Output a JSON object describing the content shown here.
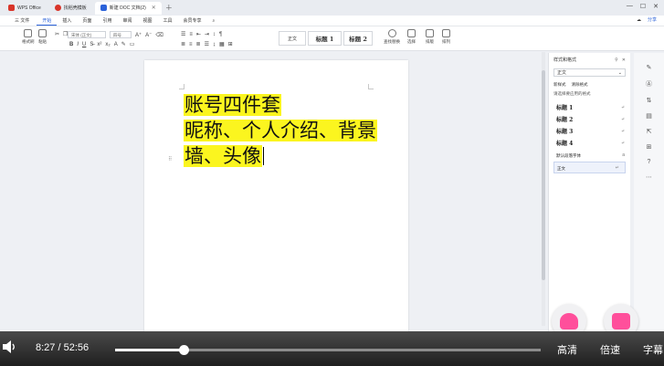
{
  "tabs": [
    {
      "label": "WPS Office",
      "color": "#d9352a"
    },
    {
      "label": "找稻壳模板",
      "color": "#d9352a"
    },
    {
      "label": "新建 DOC 文档(2)",
      "color": "#2b62d9",
      "active": true
    }
  ],
  "menu": {
    "file": "三 文件",
    "items": [
      "开始",
      "插入",
      "页面",
      "引用",
      "审阅",
      "视图",
      "工具",
      "会员专享"
    ],
    "active_index": 0,
    "share": "分享"
  },
  "toolbar": {
    "format_painter": "格式刷",
    "paste": "粘贴",
    "font_name": "宋体 (正文)",
    "font_size": "四号",
    "style_normal": "正文",
    "style_h1": "标题 1",
    "style_h2": "标题 2",
    "find_replace": "查找替换",
    "select": "选择",
    "sort": "排版",
    "layout": "排列"
  },
  "document": {
    "lines": [
      "账号四件套",
      "昵称、个人介绍、背景",
      "墙、头像"
    ]
  },
  "styles_pane": {
    "title": "样式和格式",
    "current_style": "正文",
    "new_style": "新样式",
    "clear_format": "清除格式",
    "caption": "请选择要应用的格式",
    "items": [
      {
        "label": "标题 1",
        "kind": "heading"
      },
      {
        "label": "标题 2",
        "kind": "heading"
      },
      {
        "label": "标题 3",
        "kind": "heading"
      },
      {
        "label": "标题 4",
        "kind": "heading"
      },
      {
        "label": "默认段落字体",
        "kind": "small"
      },
      {
        "label": "正文",
        "kind": "selected"
      }
    ]
  },
  "player": {
    "current_time": "8:27",
    "separator": "/",
    "total_time": "52:56",
    "progress": 0.1604,
    "quality_label": "高清",
    "speed_label": "倍速",
    "subtitle_label": "字幕"
  },
  "colors": {
    "highlight": "#fbf51f",
    "accent": "#2b62d9",
    "badge_pink": "#ff4f9b"
  }
}
